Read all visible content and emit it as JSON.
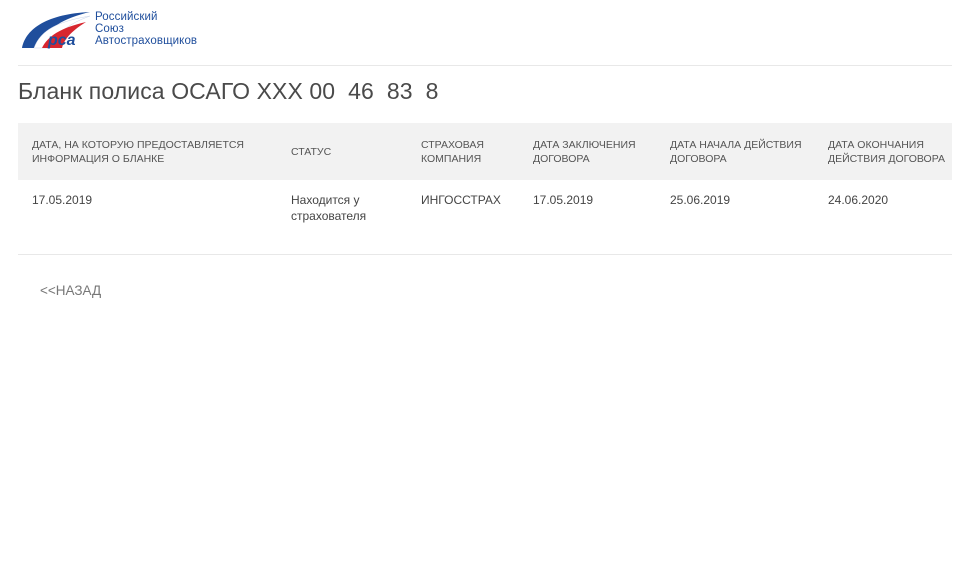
{
  "header": {
    "logo": {
      "line1": "Российский",
      "line2": "Союз",
      "line3": "Автостраховщиков",
      "emblem_text": "рса",
      "colors": {
        "blue": "#1f4e9c",
        "red": "#d7262f"
      }
    }
  },
  "page": {
    "title": "Бланк полиса ОСАГО XXX 00  46  83  8"
  },
  "table": {
    "headers": [
      "ДАТА, НА КОТОРУЮ ПРЕДОСТАВЛЯЕТСЯ ИНФОРМАЦИЯ О БЛАНКЕ",
      "СТАТУС",
      "СТРАХОВАЯ КОМПАНИЯ",
      "ДАТА ЗАКЛЮЧЕНИЯ ДОГОВОРА",
      "ДАТА НАЧАЛА ДЕЙСТВИЯ ДОГОВОРА",
      "ДАТА ОКОНЧАНИЯ ДЕЙСТВИЯ ДОГОВОРА"
    ],
    "rows": [
      [
        "17.05.2019",
        "Находится у страхователя",
        "ИНГОССТРАХ",
        "17.05.2019",
        "25.06.2019",
        "24.06.2020"
      ]
    ]
  },
  "nav": {
    "back_label": "<<НАЗАД"
  }
}
